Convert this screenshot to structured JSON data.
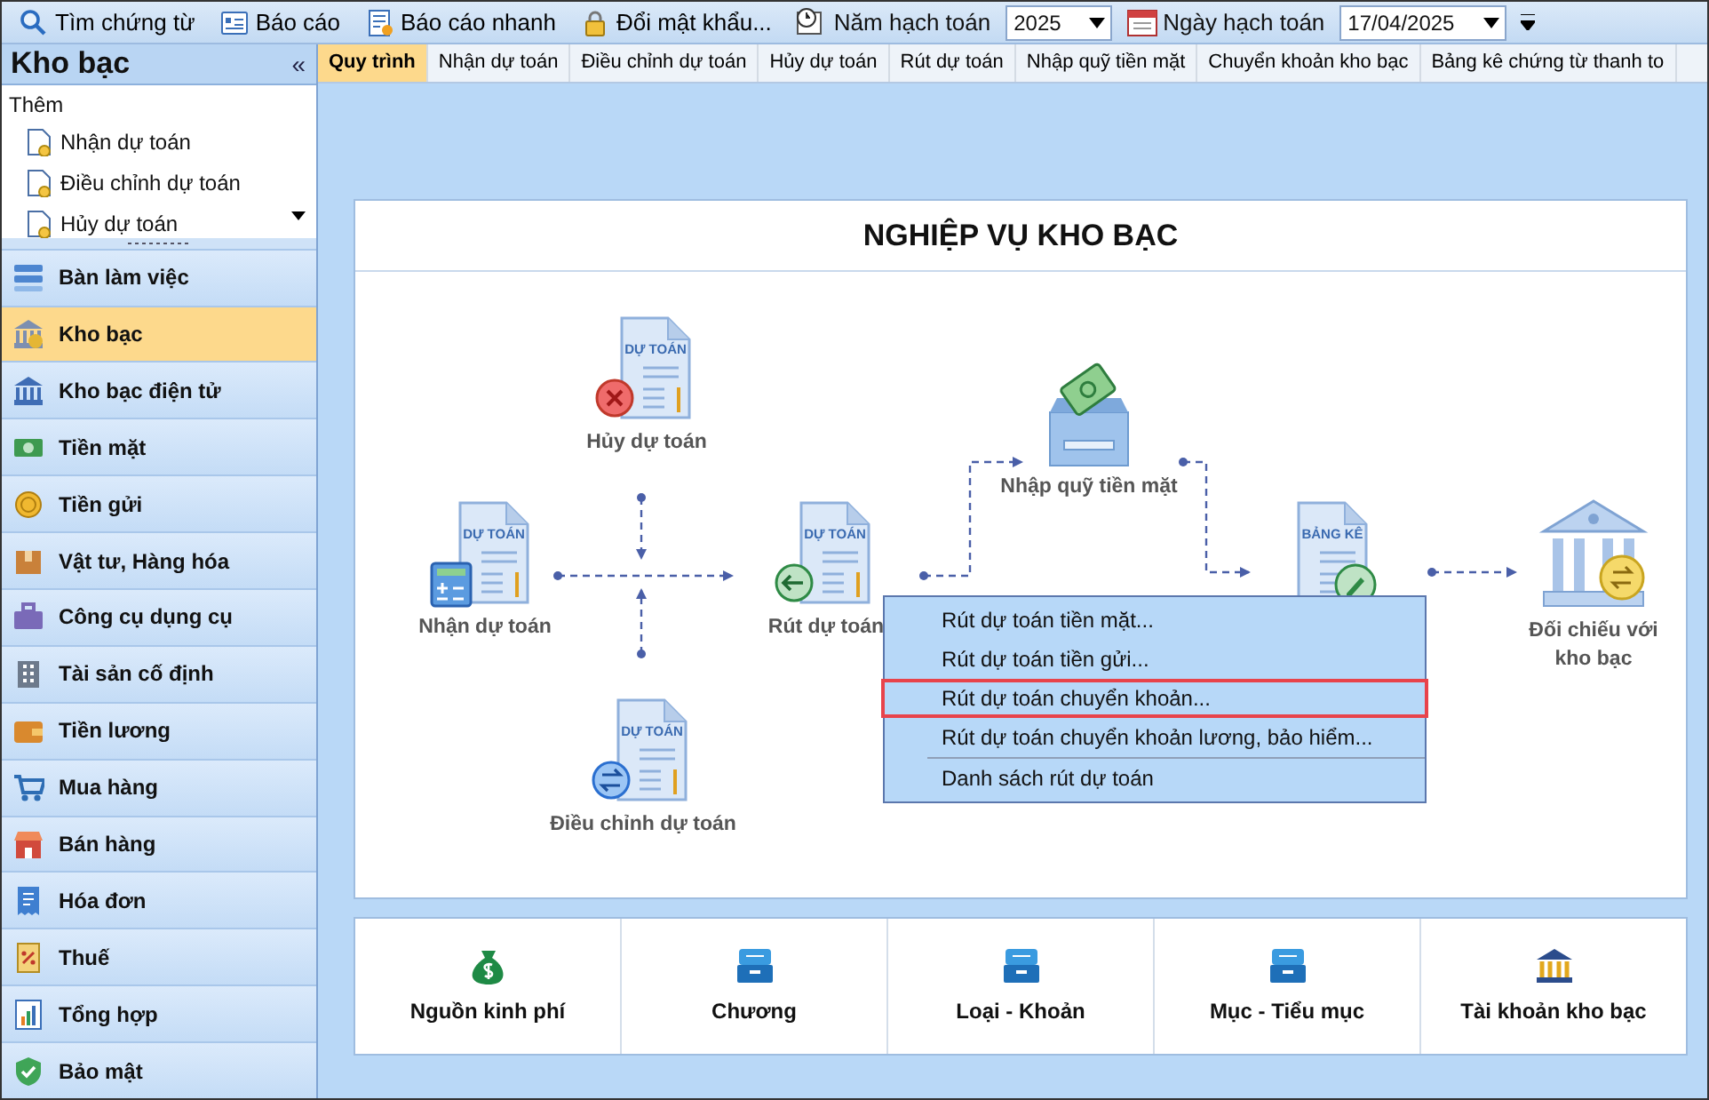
{
  "toolbar": {
    "items": [
      {
        "kind": "search",
        "label": "Tìm chứng từ"
      },
      {
        "kind": "report",
        "label": "Báo cáo"
      },
      {
        "kind": "quick-report",
        "label": "Báo cáo nhanh"
      },
      {
        "kind": "lock",
        "label": "Đổi mật khẩu..."
      }
    ],
    "year": {
      "label": "Năm hạch toán",
      "value": "2025"
    },
    "date": {
      "label": "Ngày hạch toán",
      "value": "17/04/2025"
    }
  },
  "sidebar": {
    "title": "Kho bạc",
    "collapse": "«",
    "quick_add": {
      "title": "Thêm",
      "items": [
        "Nhận dự toán",
        "Điều chỉnh dự toán",
        "Hủy dự toán"
      ]
    },
    "modules": [
      {
        "kind": "desk",
        "label": "Bàn làm việc",
        "selected": false
      },
      {
        "kind": "bank",
        "label": "Kho bạc",
        "selected": true
      },
      {
        "kind": "bank-online",
        "label": "Kho bạc điện tử",
        "selected": false
      },
      {
        "kind": "cash",
        "label": "Tiền mặt",
        "selected": false
      },
      {
        "kind": "coin",
        "label": "Tiền gửi",
        "selected": false
      },
      {
        "kind": "box",
        "label": "Vật tư, Hàng hóa",
        "selected": false
      },
      {
        "kind": "tools",
        "label": "Công cụ dụng cụ",
        "selected": false
      },
      {
        "kind": "building",
        "label": "Tài sản cố định",
        "selected": false
      },
      {
        "kind": "salary",
        "label": "Tiền lương",
        "selected": false
      },
      {
        "kind": "cart",
        "label": "Mua hàng",
        "selected": false
      },
      {
        "kind": "store",
        "label": "Bán hàng",
        "selected": false
      },
      {
        "kind": "invoice",
        "label": "Hóa đơn",
        "selected": false
      },
      {
        "kind": "tax",
        "label": "Thuế",
        "selected": false
      },
      {
        "kind": "report",
        "label": "Tổng hợp",
        "selected": false
      },
      {
        "kind": "shield",
        "label": "Bảo mật",
        "selected": false
      }
    ]
  },
  "tabs": [
    {
      "label": "Quy trình",
      "selected": true
    },
    {
      "label": "Nhận dự toán",
      "selected": false
    },
    {
      "label": "Điều chỉnh dự toán",
      "selected": false
    },
    {
      "label": "Hủy dự toán",
      "selected": false
    },
    {
      "label": "Rút dự toán",
      "selected": false
    },
    {
      "label": "Nhập quỹ tiền mặt",
      "selected": false
    },
    {
      "label": "Chuyển khoản kho bạc",
      "selected": false
    },
    {
      "label": "Bảng kê chứng từ thanh to",
      "selected": false
    }
  ],
  "diagram": {
    "title": "NGHIỆP VỤ KHO BẠC",
    "nodes": [
      {
        "kind": "cancel-document",
        "doc_label": "DỰ TOÁN",
        "label": "Hủy dự toán"
      },
      {
        "kind": "receive-document",
        "doc_label": "DỰ TOÁN",
        "label": "Nhận dự toán"
      },
      {
        "kind": "withdraw-document",
        "doc_label": "DỰ TOÁN",
        "label": "Rút dự toán"
      },
      {
        "kind": "adjust-document",
        "doc_label": "DỰ TOÁN",
        "label": "Điều chỉnh dự toán"
      },
      {
        "kind": "cash-drawer",
        "label": "Nhập quỹ tiền mặt"
      },
      {
        "kind": "list-document",
        "doc_label": "BẢNG KÊ"
      },
      {
        "kind": "bank",
        "label": "Đối chiếu với kho bạc"
      }
    ]
  },
  "context_menu": {
    "items": [
      {
        "label": "Rút dự toán tiền mặt...",
        "selected": false,
        "separator_before": false
      },
      {
        "label": "Rút dự toán tiền gửi...",
        "selected": false,
        "separator_before": false
      },
      {
        "label": "Rút dự toán chuyển khoản...",
        "selected": true,
        "separator_before": false
      },
      {
        "label": "Rút dự toán chuyển khoản lương, bảo hiểm...",
        "selected": false,
        "separator_before": false
      },
      {
        "label": "Danh sách rút dự toán",
        "selected": false,
        "separator_before": true
      }
    ]
  },
  "catalog": [
    {
      "kind": "money-bag",
      "label": "Nguồn kinh phí"
    },
    {
      "kind": "tray",
      "label": "Chương"
    },
    {
      "kind": "tray",
      "label": "Loại - Khoản"
    },
    {
      "kind": "tray",
      "label": "Mục - Tiểu mục"
    },
    {
      "kind": "bank",
      "label": "Tài khoản kho bạc"
    }
  ]
}
